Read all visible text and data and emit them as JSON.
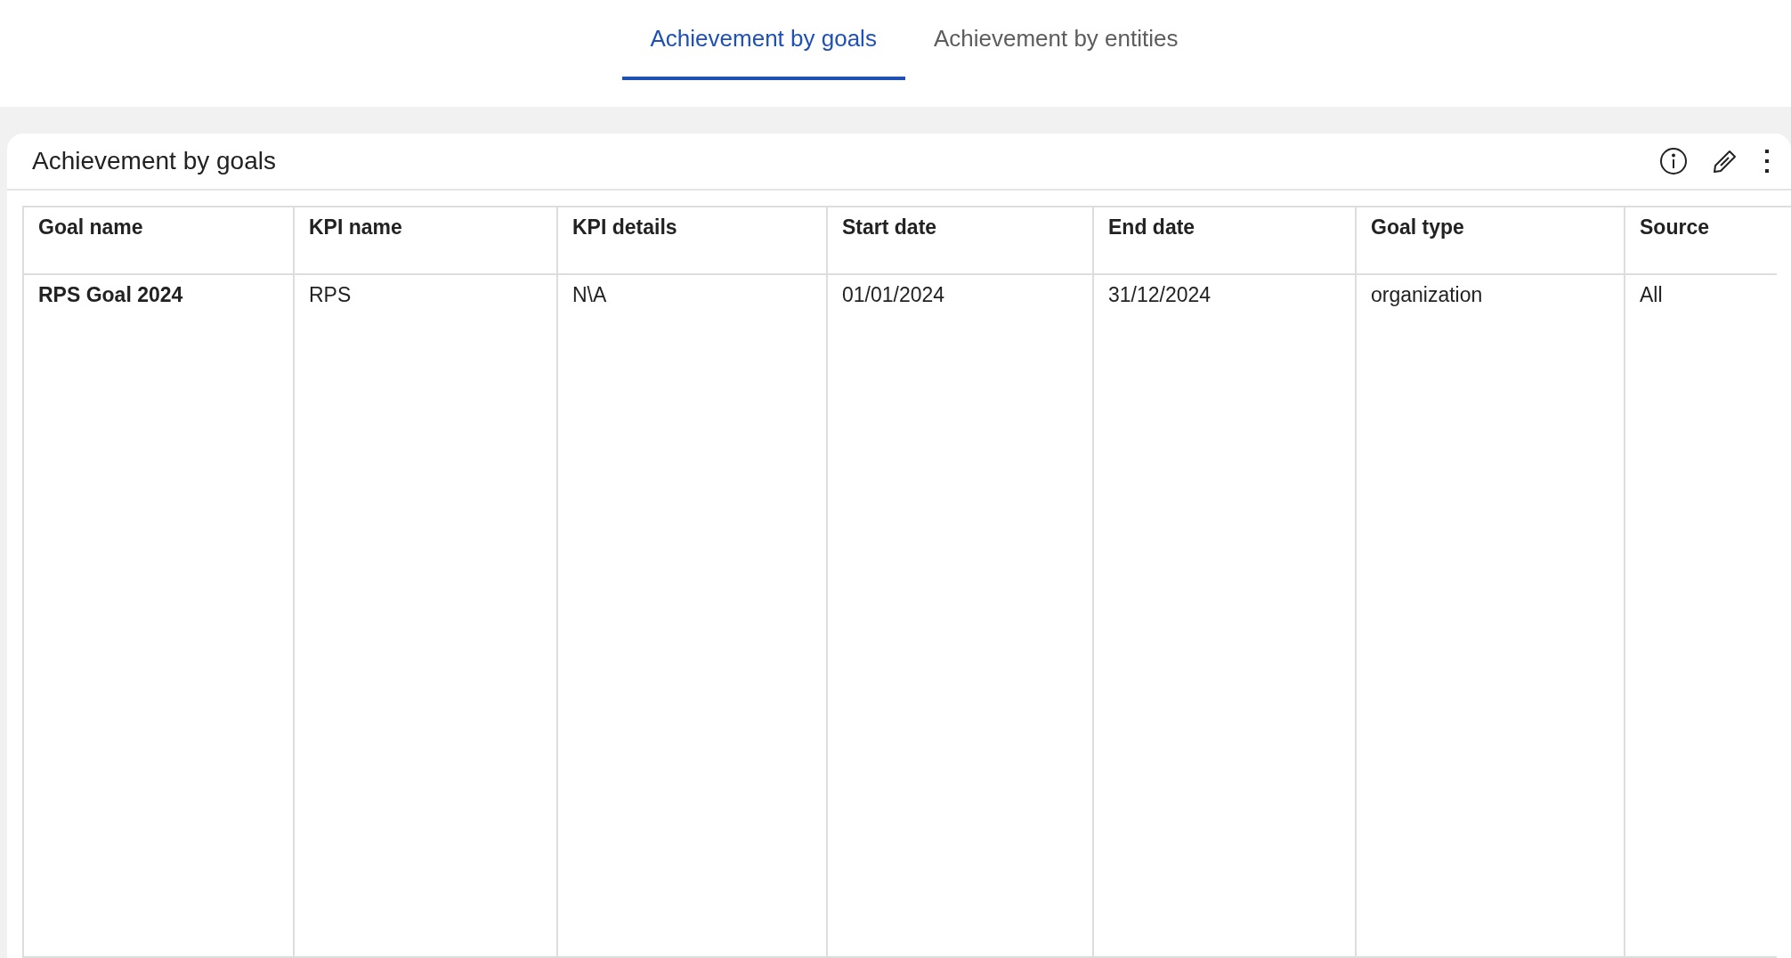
{
  "tabs": [
    {
      "label": "Achievement by goals",
      "selected": true
    },
    {
      "label": "Achievement by entities",
      "selected": false
    }
  ],
  "card": {
    "title": "Achievement by goals"
  },
  "table": {
    "columns": [
      "Goal name",
      "KPI name",
      "KPI details",
      "Start date",
      "End date",
      "Goal type",
      "Source"
    ],
    "rows": [
      {
        "cells": [
          "RPS Goal 2024",
          "RPS",
          "N\\A",
          "01/01/2024",
          "31/12/2024",
          "organization",
          "All"
        ]
      }
    ]
  }
}
